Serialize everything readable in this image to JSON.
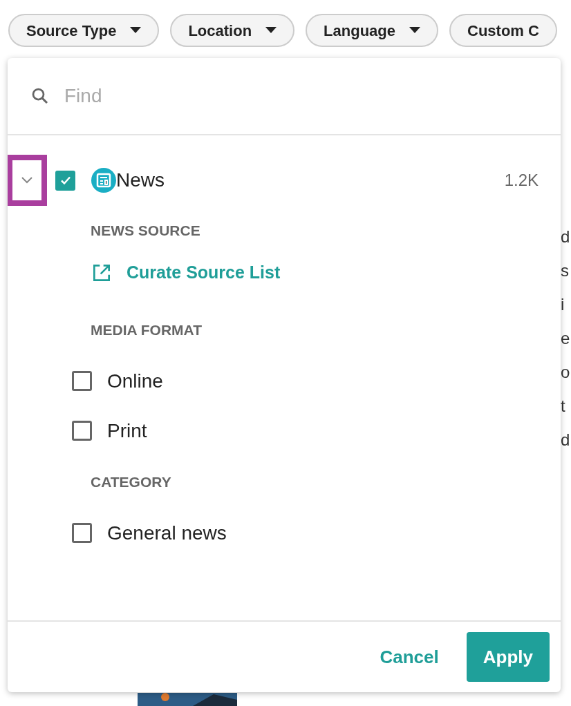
{
  "filter_chips": [
    {
      "label": "Source Type",
      "caret": true
    },
    {
      "label": "Location",
      "caret": true
    },
    {
      "label": "Language",
      "caret": true
    },
    {
      "label": "Custom C",
      "caret": false
    }
  ],
  "background": {
    "right_fragments": [
      "d",
      "s",
      "i",
      "e",
      "o",
      "t",
      "d"
    ]
  },
  "dropdown": {
    "search": {
      "placeholder": "Find"
    },
    "source": {
      "label": "News",
      "count": "1.2K",
      "checked": true,
      "expanded": true,
      "highlighted": true
    },
    "sections": [
      {
        "heading": "NEWS SOURCE",
        "kind": "link",
        "link": "Curate Source List"
      },
      {
        "heading": "MEDIA FORMAT",
        "kind": "options",
        "options": [
          {
            "label": "Online",
            "checked": false
          },
          {
            "label": "Print",
            "checked": false
          }
        ]
      },
      {
        "heading": "CATEGORY",
        "kind": "options",
        "options": [
          {
            "label": "General news",
            "checked": false
          }
        ]
      }
    ],
    "buttons": {
      "cancel": "Cancel",
      "apply": "Apply"
    }
  }
}
